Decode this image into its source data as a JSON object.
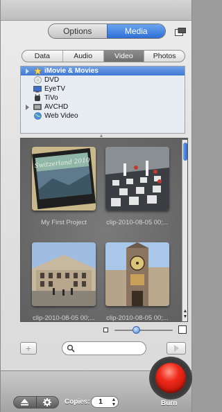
{
  "top_segment": {
    "options": "Options",
    "media": "Media"
  },
  "media_tabs": {
    "data": "Data",
    "audio": "Audio",
    "video": "Video",
    "photos": "Photos"
  },
  "sources": [
    {
      "label": "iMovie & Movies",
      "icon": "imovie-star-icon",
      "expandable": true,
      "selected": true
    },
    {
      "label": "DVD",
      "icon": "dvd-disc-icon",
      "expandable": false,
      "selected": false
    },
    {
      "label": "EyeTV",
      "icon": "eyetv-icon",
      "expandable": false,
      "selected": false
    },
    {
      "label": "TiVo",
      "icon": "tivo-icon",
      "expandable": false,
      "selected": false
    },
    {
      "label": "AVCHD",
      "icon": "avchd-icon",
      "expandable": true,
      "selected": false
    },
    {
      "label": "Web Video",
      "icon": "globe-icon",
      "expandable": false,
      "selected": false
    }
  ],
  "clips": [
    {
      "title": "My First Project",
      "thumb_text": "Switzerland 2010"
    },
    {
      "title": "clip-2010-08-05 00;..."
    },
    {
      "title": "clip-2010-08-05 00;..."
    },
    {
      "title": "clip-2010-08-05 00;..."
    }
  ],
  "search": {
    "placeholder": "",
    "value": ""
  },
  "footer": {
    "copies_label": "Copies:",
    "copies_value": "1",
    "burn_label": "Burn"
  },
  "colors": {
    "accent": "#3f78d4",
    "burn": "#ef2a1a"
  }
}
